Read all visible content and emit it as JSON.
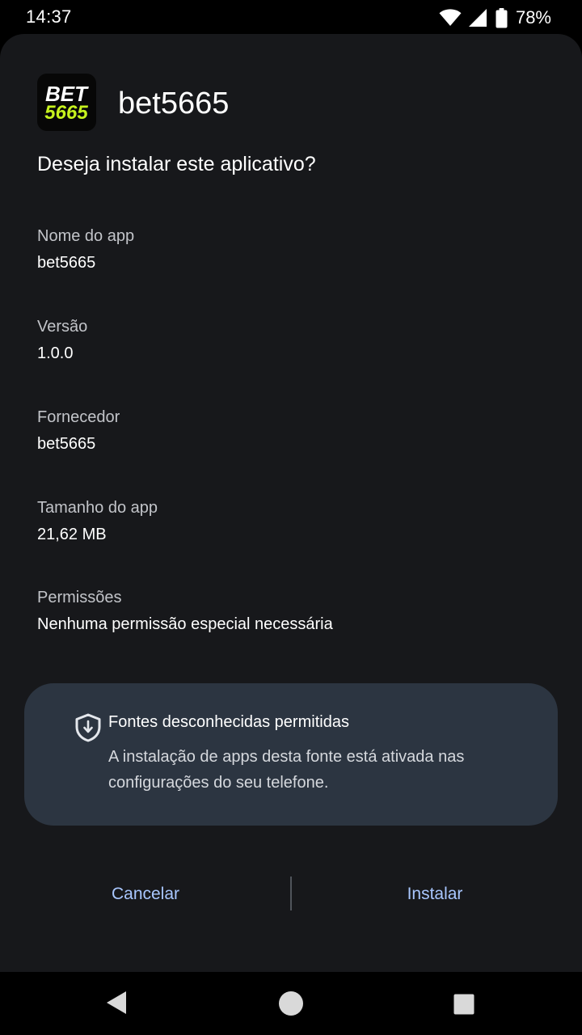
{
  "status_bar": {
    "time": "14:37",
    "battery_percent": "78%",
    "icons": [
      "wifi-icon",
      "signal-icon",
      "battery-icon"
    ]
  },
  "dialog": {
    "app_icon": {
      "line1": "BET",
      "line2": "5665",
      "accent_color": "#c6f21e"
    },
    "app_title": "bet5665",
    "question": "Deseja instalar este aplicativo?",
    "info": [
      {
        "label": "Nome do app",
        "value": "bet5665"
      },
      {
        "label": "Versão",
        "value": "1.0.0"
      },
      {
        "label": "Fornecedor",
        "value": "bet5665"
      },
      {
        "label": "Tamanho do app",
        "value": "21,62 MB"
      },
      {
        "label": "Permissões",
        "value": "Nenhuma permissão especial necessária"
      }
    ],
    "notice": {
      "icon": "shield-icon",
      "title": "Fontes desconhecidas permitidas",
      "body": "A instalação de apps desta fonte está ativada nas configurações do seu telefone."
    },
    "buttons": {
      "cancel_label": "Cancelar",
      "install_label": "Instalar",
      "color": "#a9c7ff"
    }
  },
  "nav_bar": {
    "icons": [
      "back-icon",
      "home-icon",
      "recents-icon"
    ]
  },
  "colors": {
    "sheet_background": "#17181b",
    "notice_background": "#2c3541"
  }
}
